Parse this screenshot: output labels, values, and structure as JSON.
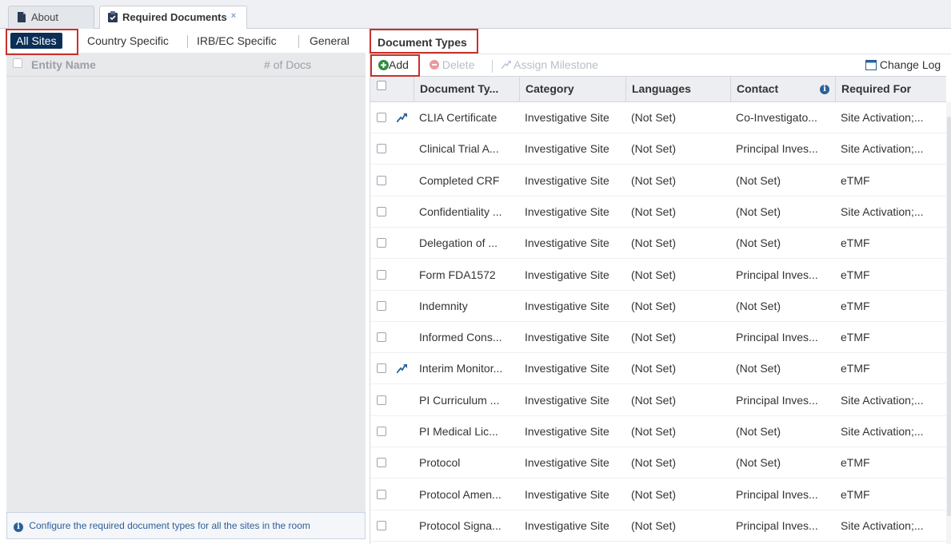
{
  "tabs": [
    {
      "label": "About",
      "icon": "document-icon"
    },
    {
      "label": "Required Documents",
      "icon": "clipboard-icon",
      "close": "×"
    }
  ],
  "site_tabs": [
    "All Sites",
    "Country Specific",
    "IRB/EC Specific",
    "General"
  ],
  "left_panel": {
    "columns": [
      "Entity Name",
      "# of Docs"
    ],
    "info_text": "Configure the required document types for all the sites in the room"
  },
  "right_panel": {
    "title": "Document Types",
    "toolbar": {
      "add": "Add",
      "delete": "Delete",
      "assign_milestone": "Assign Milestone",
      "change_log": "Change Log"
    },
    "columns": [
      "Document Ty...",
      "Category",
      "Languages",
      "Contact",
      "Required For"
    ],
    "rows": [
      {
        "name": "CLIA Certificate",
        "category": "Investigative Site",
        "languages": "(Not Set)",
        "contact": "Co-Investigato...",
        "required_for": "Site Activation;...",
        "milestone": true
      },
      {
        "name": "Clinical Trial A...",
        "category": "Investigative Site",
        "languages": "(Not Set)",
        "contact": "Principal Inves...",
        "required_for": "Site Activation;...",
        "milestone": false
      },
      {
        "name": "Completed CRF",
        "category": "Investigative Site",
        "languages": "(Not Set)",
        "contact": "(Not Set)",
        "required_for": "eTMF",
        "milestone": false
      },
      {
        "name": "Confidentiality ...",
        "category": "Investigative Site",
        "languages": "(Not Set)",
        "contact": "(Not Set)",
        "required_for": "Site Activation;...",
        "milestone": false
      },
      {
        "name": "Delegation of ...",
        "category": "Investigative Site",
        "languages": "(Not Set)",
        "contact": "(Not Set)",
        "required_for": "eTMF",
        "milestone": false
      },
      {
        "name": "Form FDA1572",
        "category": "Investigative Site",
        "languages": "(Not Set)",
        "contact": "Principal Inves...",
        "required_for": "eTMF",
        "milestone": false
      },
      {
        "name": "Indemnity",
        "category": "Investigative Site",
        "languages": "(Not Set)",
        "contact": "(Not Set)",
        "required_for": "eTMF",
        "milestone": false
      },
      {
        "name": "Informed Cons...",
        "category": "Investigative Site",
        "languages": "(Not Set)",
        "contact": "Principal Inves...",
        "required_for": "eTMF",
        "milestone": false
      },
      {
        "name": "Interim Monitor...",
        "category": "Investigative Site",
        "languages": "(Not Set)",
        "contact": "(Not Set)",
        "required_for": "eTMF",
        "milestone": true
      },
      {
        "name": "PI Curriculum ...",
        "category": "Investigative Site",
        "languages": "(Not Set)",
        "contact": "Principal Inves...",
        "required_for": "Site Activation;...",
        "milestone": false
      },
      {
        "name": "PI Medical Lic...",
        "category": "Investigative Site",
        "languages": "(Not Set)",
        "contact": "(Not Set)",
        "required_for": "Site Activation;...",
        "milestone": false
      },
      {
        "name": "Protocol",
        "category": "Investigative Site",
        "languages": "(Not Set)",
        "contact": "(Not Set)",
        "required_for": "eTMF",
        "milestone": false
      },
      {
        "name": "Protocol Amen...",
        "category": "Investigative Site",
        "languages": "(Not Set)",
        "contact": "Principal Inves...",
        "required_for": "eTMF",
        "milestone": false
      },
      {
        "name": "Protocol Signa...",
        "category": "Investigative Site",
        "languages": "(Not Set)",
        "contact": "Principal Inves...",
        "required_for": "Site Activation;...",
        "milestone": false
      }
    ]
  },
  "colors": {
    "active_tab_bg": "#0b2f57",
    "highlight": "#c9302c",
    "add_green": "#2e8b3e",
    "delete_red": "#e07a7a",
    "info_blue": "#2d5f98"
  }
}
